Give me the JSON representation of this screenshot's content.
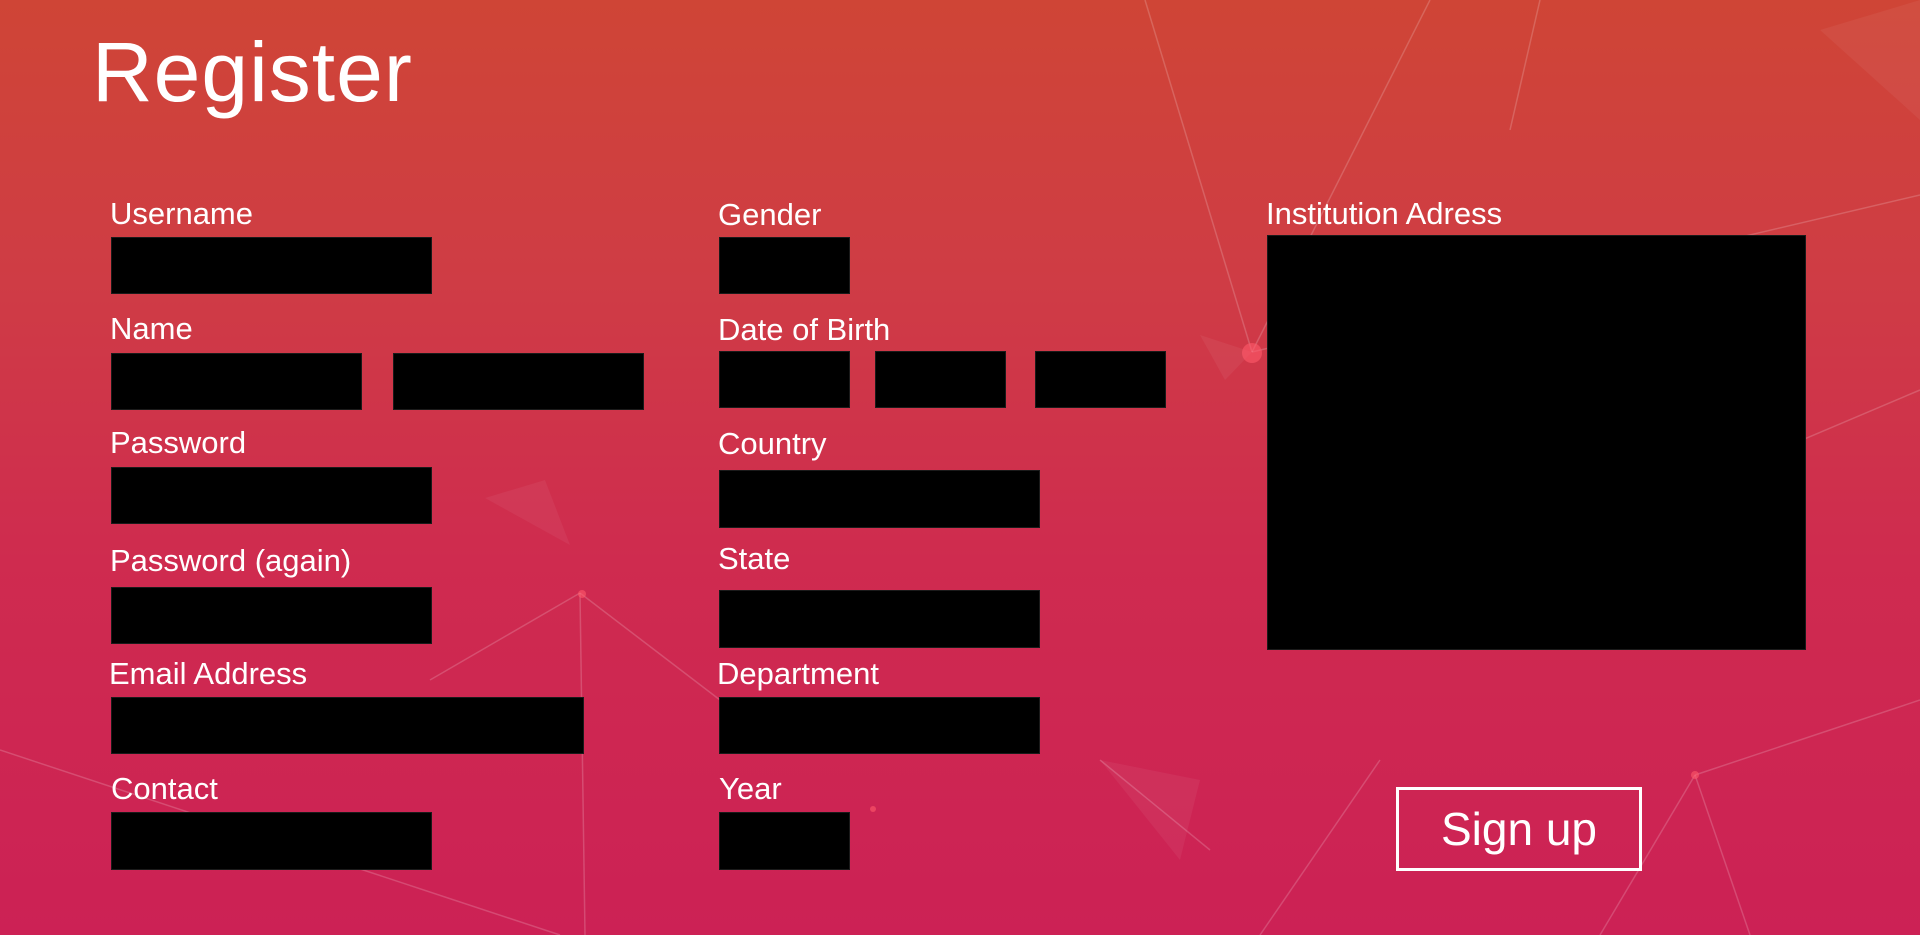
{
  "page": {
    "title": "Register",
    "colors": {
      "gradient_top": "#cf4536",
      "gradient_bottom": "#cc2155",
      "field_background": "#000000",
      "text": "#ffffff"
    }
  },
  "form": {
    "username": {
      "label": "Username",
      "value": ""
    },
    "name": {
      "label": "Name",
      "first_value": "",
      "last_value": ""
    },
    "password": {
      "label": "Password",
      "value": ""
    },
    "password_again": {
      "label": "Password (again)",
      "value": ""
    },
    "email": {
      "label": "Email Address",
      "value": ""
    },
    "contact": {
      "label": "Contact",
      "value": ""
    },
    "gender": {
      "label": "Gender",
      "value": ""
    },
    "date_of_birth": {
      "label": "Date of Birth",
      "day": "",
      "month": "",
      "year": ""
    },
    "country": {
      "label": "Country",
      "value": ""
    },
    "state": {
      "label": "State",
      "value": ""
    },
    "department": {
      "label": "Department",
      "value": ""
    },
    "year": {
      "label": "Year",
      "value": ""
    },
    "institution_address": {
      "label": "Institution Adress",
      "value": ""
    },
    "submit_label": "Sign up"
  }
}
